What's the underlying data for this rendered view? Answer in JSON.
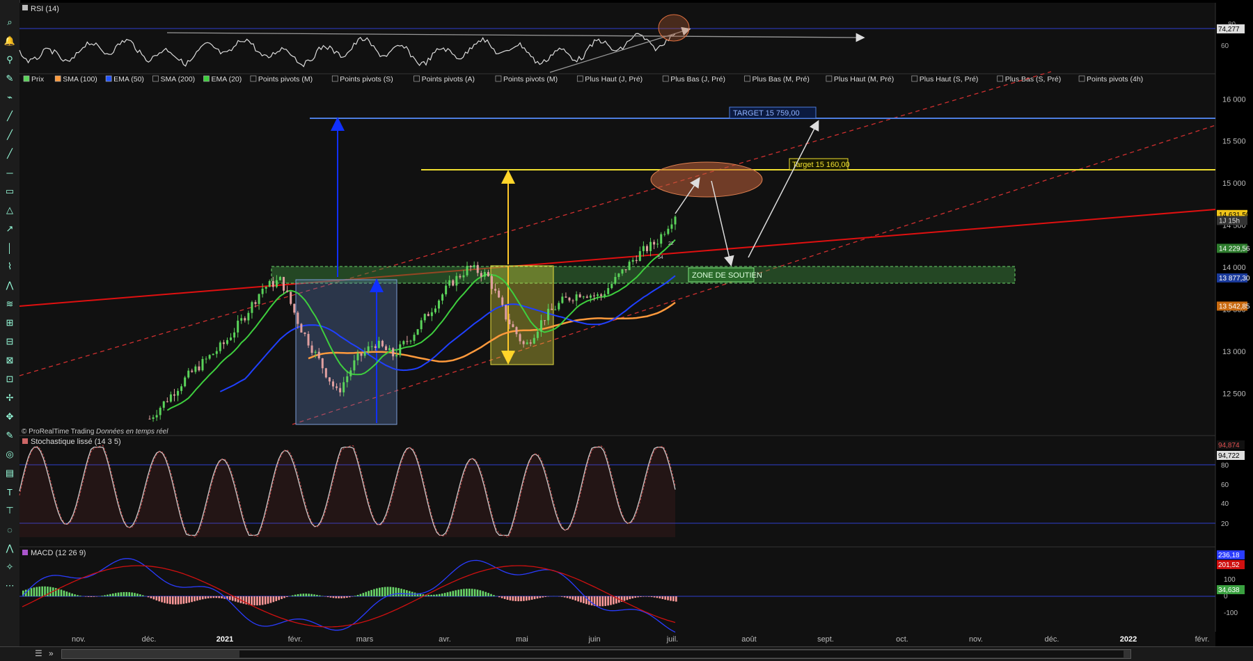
{
  "panels": {
    "rsi": {
      "title": "RSI (14)",
      "last_value": "74,277",
      "ticks": [
        "80",
        "60"
      ]
    },
    "price": {
      "legend": [
        {
          "label": "Prix",
          "color": "#5ad35a",
          "checked": true
        },
        {
          "label": "SMA (100)",
          "color": "#ff9a3c",
          "checked": true
        },
        {
          "label": "EMA (50)",
          "color": "#2255ff",
          "checked": true
        },
        {
          "label": "SMA (200)",
          "color": "#888888",
          "checked": false
        },
        {
          "label": "EMA (20)",
          "color": "#3ecf3e",
          "checked": true
        },
        {
          "label": "Points pivots (M)",
          "color": "#888888",
          "checked": false
        },
        {
          "label": "Points pivots (S)",
          "color": "#888888",
          "checked": false
        },
        {
          "label": "Points pivots (A)",
          "color": "#888888",
          "checked": false
        },
        {
          "label": "Points pivots (M)",
          "color": "#888888",
          "checked": false
        },
        {
          "label": "Plus Haut (J, Pré)",
          "color": "#888888",
          "checked": false
        },
        {
          "label": "Plus Bas (J, Pré)",
          "color": "#888888",
          "checked": false
        },
        {
          "label": "Plus Bas (M, Pré)",
          "color": "#888888",
          "checked": false
        },
        {
          "label": "Plus Haut (M, Pré)",
          "color": "#888888",
          "checked": false
        },
        {
          "label": "Plus Haut (S, Pré)",
          "color": "#888888",
          "checked": false
        },
        {
          "label": "Plus Bas (S, Pré)",
          "color": "#888888",
          "checked": false
        },
        {
          "label": "Points pivots (4h)",
          "color": "#888888",
          "checked": false
        }
      ],
      "price_ticks": [
        "16 000",
        "15 500",
        "15 000",
        "14 500",
        "14 000",
        "13 500",
        "13 000",
        "12 500"
      ],
      "value_labels": [
        {
          "text": "14 631,50",
          "bg": "#f0c419",
          "fg": "#000"
        },
        {
          "text": "1J 15h",
          "bg": "#333333",
          "fg": "#ddd"
        },
        {
          "text": "14 229,56",
          "bg": "#2e7d2e",
          "fg": "#fff"
        },
        {
          "text": "13 877,30",
          "bg": "#1a3a9a",
          "fg": "#fff"
        },
        {
          "text": "13 542,85",
          "bg": "#c86a10",
          "fg": "#fff"
        }
      ],
      "annotations": {
        "target_high": "TARGET 15 759,00",
        "target_low": "Target 15 160,00",
        "zone": "ZONE DE SOUTIEN"
      },
      "watermark": "© ProRealTime Trading",
      "watermark_italic": "Données en temps réel",
      "small_labels": [
        "22",
        "54"
      ]
    },
    "stoch": {
      "title": "Stochastique lissé (14 3 5)",
      "ticks": [
        "80",
        "60",
        "40",
        "20"
      ],
      "v1": "94,874",
      "v2": "94,722",
      "v1_color": "#e05050",
      "v2_color": "#dddddd"
    },
    "macd": {
      "title": "MACD (12 26 9)",
      "ticks": [
        "100",
        "0",
        "-100"
      ],
      "v1": "236,18",
      "v2": "201,52",
      "v3": "34,638",
      "v1_color": "#2a3cff",
      "v2_color": "#d01010",
      "v3_color": "#3aa040"
    }
  },
  "time_axis": [
    "nov.",
    "déc.",
    "2021",
    "févr.",
    "mars",
    "avr.",
    "mai",
    "juin",
    "juil.",
    "août",
    "sept.",
    "oct.",
    "nov.",
    "déc.",
    "2022",
    "févr."
  ],
  "chart_data": {
    "type": "line",
    "title": "",
    "instrument_note": "Daily candlestick chart with RSI, Stochastic and MACD",
    "x_range": [
      "2020-10",
      "2022-02"
    ],
    "ylim": [
      12000,
      16300
    ],
    "series": [
      {
        "name": "Prix",
        "approx_closes": [
          12200,
          12450,
          12700,
          12900,
          13100,
          13400,
          13750,
          13850,
          13300,
          12900,
          12500,
          12900,
          13100,
          12950,
          13200,
          13500,
          13800,
          14000,
          13900,
          13400,
          13050,
          13400,
          13600,
          13700,
          13650,
          13900,
          14150,
          14300,
          14631.5
        ]
      },
      {
        "name": "EMA (20)",
        "last": 14229.56
      },
      {
        "name": "EMA (50)",
        "last": 13877.3
      },
      {
        "name": "SMA (100)",
        "last": 13542.85
      }
    ],
    "levels": {
      "target_high": 15759,
      "target_low": 15160,
      "support_zone": [
        13800,
        14050
      ]
    },
    "rsi_last": 74.277,
    "stoch_last": [
      94.874,
      94.722
    ],
    "macd_last": [
      236.18,
      201.52,
      34.638
    ]
  },
  "bottom_bar": {
    "menu": "☰",
    "nav": "»"
  }
}
